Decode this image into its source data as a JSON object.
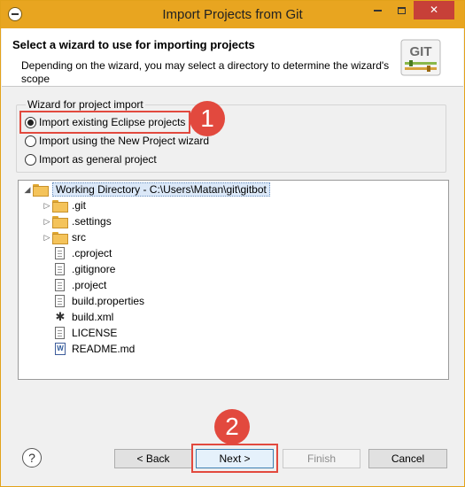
{
  "window": {
    "title": "Import Projects from Git",
    "accent_color": "#e8a520",
    "minimize_icon": "minimize-icon",
    "maximize_icon": "maximize-icon",
    "close_label": "✕"
  },
  "banner": {
    "title": "Select a wizard to use for importing projects",
    "description": "Depending on the wizard, you may select a directory to determine the wizard's scope",
    "logo_text": "GIT"
  },
  "wizard_group": {
    "title": "Wizard for project import",
    "options": [
      {
        "label": "Import existing Eclipse projects",
        "selected": true
      },
      {
        "label": "Import using the New Project wizard",
        "selected": false
      },
      {
        "label": "Import as general project",
        "selected": false
      }
    ]
  },
  "annotations": {
    "step1": "1",
    "step2": "2",
    "highlight_color": "#e2493e"
  },
  "tree": {
    "root": {
      "label": "Working Directory - C:\\Users\\Matan\\git\\gitbot",
      "expanded": true
    },
    "items": [
      {
        "label": ".git",
        "type": "folder",
        "expandable": true
      },
      {
        "label": ".settings",
        "type": "folder",
        "expandable": true
      },
      {
        "label": "src",
        "type": "folder",
        "expandable": true
      },
      {
        "label": ".cproject",
        "type": "file"
      },
      {
        "label": ".gitignore",
        "type": "file"
      },
      {
        "label": ".project",
        "type": "file"
      },
      {
        "label": "build.properties",
        "type": "file"
      },
      {
        "label": "build.xml",
        "type": "ant"
      },
      {
        "label": "LICENSE",
        "type": "file"
      },
      {
        "label": "README.md",
        "type": "word"
      }
    ]
  },
  "buttons": {
    "help": "?",
    "back": "< Back",
    "next": "Next >",
    "finish": "Finish",
    "cancel": "Cancel"
  }
}
